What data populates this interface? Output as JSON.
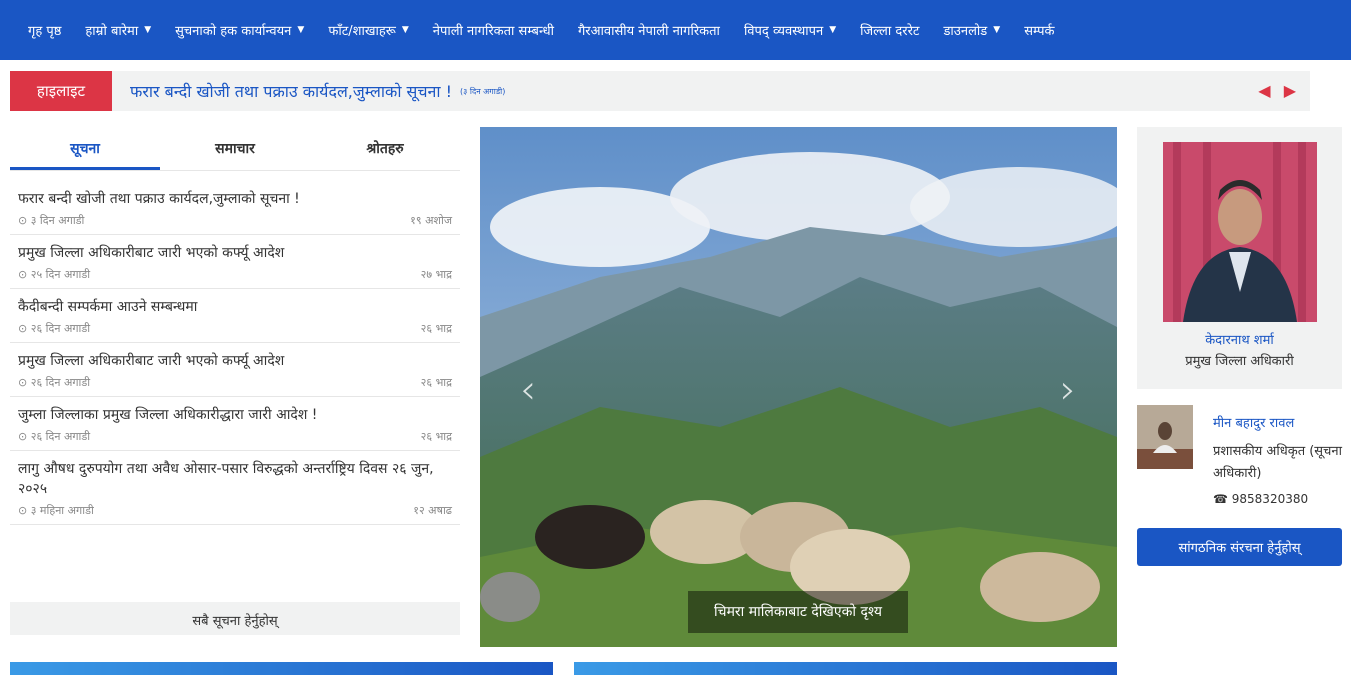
{
  "nav": {
    "items": [
      {
        "label": "गृह पृष्ठ",
        "caret": false
      },
      {
        "label": "हाम्रो बारेमा",
        "caret": true
      },
      {
        "label": "सुचनाको हक कार्यान्वयन",
        "caret": true
      },
      {
        "label": "फाँट/शाखाहरू",
        "caret": true
      },
      {
        "label": "नेपाली नागरिकता सम्बन्धी",
        "caret": false
      },
      {
        "label": "गैरआवासीय नेपाली नागरिकता",
        "caret": false
      },
      {
        "label": "विपद् व्यवस्थापन",
        "caret": true
      },
      {
        "label": "जिल्ला दररेट",
        "caret": false
      },
      {
        "label": "डाउनलोड",
        "caret": true
      },
      {
        "label": "सम्पर्क",
        "caret": false
      }
    ],
    "caret_glyph": "▼"
  },
  "highlight": {
    "badge": "हाइलाइट",
    "text": "फरार बन्दी खोजी तथा पक्राउ कार्यदल,जुम्लाको सूचना !",
    "time": "(३ दिन अगाडी)",
    "arrows": "◀ ▶"
  },
  "tabs": [
    "सूचना",
    "समाचार",
    "श्रोतहरु"
  ],
  "news": [
    {
      "title": "फरार बन्दी खोजी तथा पक्राउ कार्यदल,जुम्लाको सूचना !",
      "ago": "३ दिन अगाडी",
      "date": "१९ अशोज"
    },
    {
      "title": "प्रमुख जिल्ला अधिकारीबाट जारी भएको कर्फ्यू आदेश",
      "ago": "२५ दिन अगाडी",
      "date": "२७ भाद्र"
    },
    {
      "title": "कैदीबन्दी सम्पर्कमा आउने सम्बन्धमा",
      "ago": "२६ दिन अगाडी",
      "date": "२६ भाद्र"
    },
    {
      "title": "प्रमुख जिल्ला अधिकारीबाट जारी भएको कर्फ्यू आदेश",
      "ago": "२६ दिन अगाडी",
      "date": "२६ भाद्र"
    },
    {
      "title": "जुम्ला जिल्लाका प्रमुख जिल्ला अधिकारीद्धारा जारी आदेश !",
      "ago": "२६ दिन अगाडी",
      "date": "२६ भाद्र"
    },
    {
      "title": "लागु औषध दुरुपयोग तथा अवैध ओसार-पसार विरुद्धको अन्तर्राष्ट्रिय दिवस २६ जुन, २०२५",
      "ago": "३ महिना अगाडी",
      "date": "१२ अषाढ"
    }
  ],
  "clock_glyph": "⊙",
  "all_news": "सबै सूचना हेर्नुहोस्",
  "slider": {
    "caption": "चिमरा मालिकाबाट देखिएको दृश्य",
    "prev": "‹",
    "next": "›"
  },
  "cdo": {
    "name": "केदारनाथ शर्मा",
    "post": "प्रमुख जिल्ला अधिकारी"
  },
  "info_officer": {
    "name": "मीन बहादुर रावल",
    "post": "प्रशासकीय अधिकृत (सूचना अधिकारी)",
    "phone": "9858320380",
    "phone_icon": "phone-icon"
  },
  "org_button": "सांगठनिक संरचना हेर्नुहोस्"
}
